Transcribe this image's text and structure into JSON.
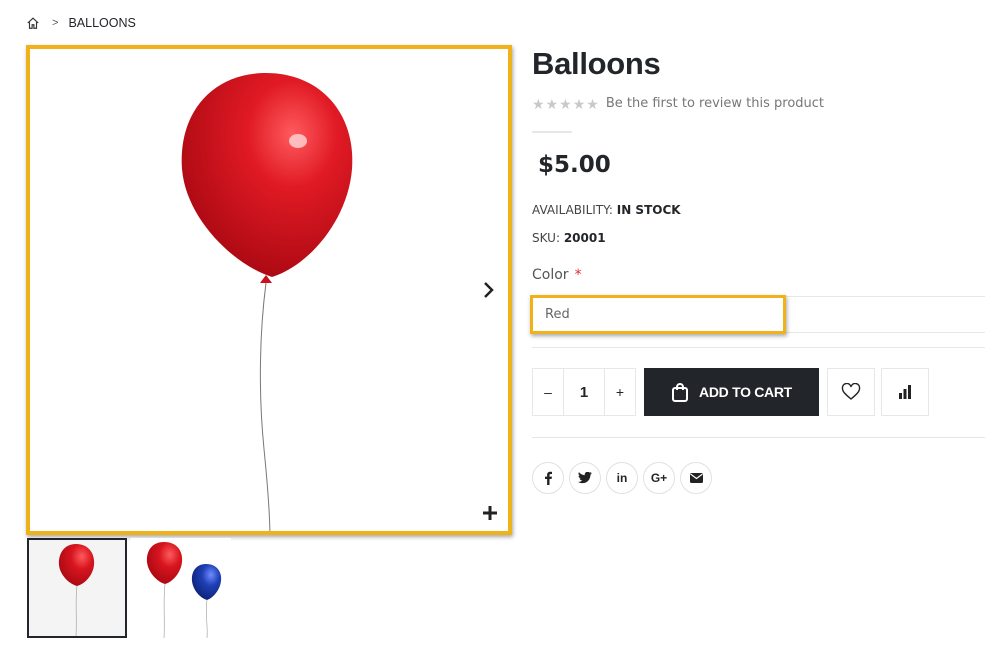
{
  "breadcrumb": {
    "home_icon": "home-icon",
    "separator": ">",
    "current": "BALLOONS"
  },
  "gallery": {
    "next_icon": "chevron-right-icon",
    "zoom_icon": "plus-icon",
    "thumbnails": [
      {
        "description": "single red balloon",
        "active": true
      },
      {
        "description": "red and blue balloons",
        "active": false
      }
    ]
  },
  "product": {
    "title": "Balloons",
    "rating_stars": 0,
    "review_link": "Be the first to review this product",
    "price": "$5.00",
    "availability_label": "AVAILABILITY:",
    "availability_value": "IN STOCK",
    "sku_label": "SKU:",
    "sku_value": "20001"
  },
  "options": {
    "color_label": "Color",
    "required_marker": "*",
    "color_selected": "Red"
  },
  "cart": {
    "qty_minus": "–",
    "qty_value": "1",
    "qty_plus": "+",
    "add_to_cart_label": "ADD TO CART"
  },
  "social": [
    "f",
    "t",
    "in",
    "G+",
    "mail"
  ],
  "colors": {
    "accent_highlight": "#f0b21a",
    "dark": "#222529",
    "balloon_red": "#d7151f",
    "balloon_blue": "#1f3fb5"
  }
}
